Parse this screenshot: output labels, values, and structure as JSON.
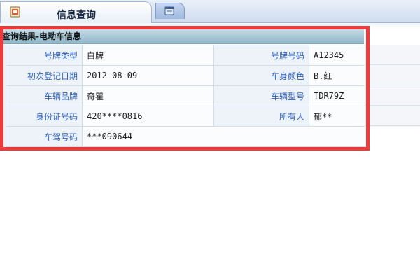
{
  "tabs": [
    {
      "label": "信息查询",
      "active": true
    },
    {
      "label": "",
      "active": false
    }
  ],
  "section": {
    "title": "查询结果-电动车信息"
  },
  "rows": [
    {
      "label1": "号牌类型",
      "value1": "白牌",
      "label2": "号牌号码",
      "value2": "A12345"
    },
    {
      "label1": "初次登记日期",
      "value1": "2012-08-09",
      "label2": "车身颜色",
      "value2": "B.红"
    },
    {
      "label1": "车辆品牌",
      "value1": "奇瞿",
      "label2": "车辆型号",
      "value2": "TDR79Z"
    },
    {
      "label1": "身份证号码",
      "value1": "420****0816",
      "label2": "所有人",
      "value2": "郁**"
    },
    {
      "label1": "车驾号码",
      "value1": "***090644"
    }
  ],
  "colors": {
    "label_text": "#2f62c0",
    "highlight_border": "#ee3b3b"
  }
}
